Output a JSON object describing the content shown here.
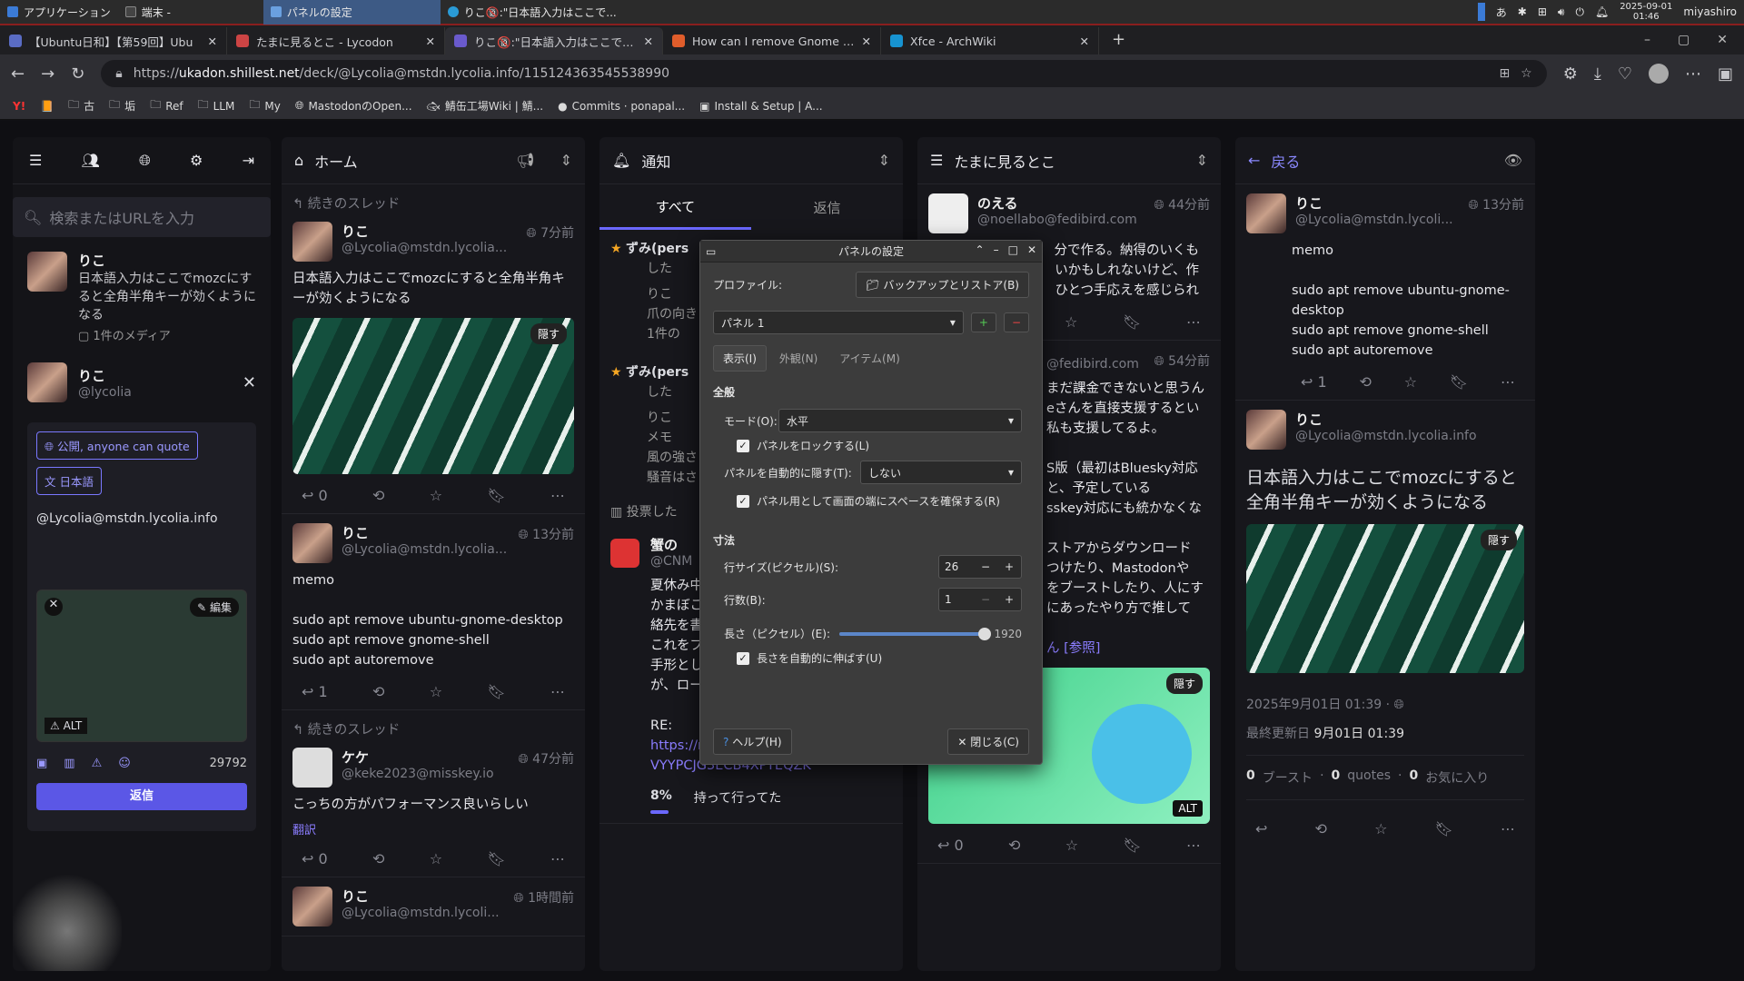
{
  "panel": {
    "apps": "アプリケーション",
    "tasks": [
      "端末 -",
      "パネルの設定",
      "りこ🔞:\"日本語入力はここで..."
    ],
    "user": "miyashiro",
    "date": "2025-09-01",
    "time": "01:46"
  },
  "tabs": [
    "【Ubuntu日和】【第59回】Ubu",
    "たまに見るとこ - Lycodon",
    "りこ🔞:\"日本語入力はここでmo",
    "How can I remove Gnome Desk",
    "Xfce - ArchWiki"
  ],
  "url": {
    "prefix": "https://",
    "host": "ukadon.shillest.net",
    "path": "/deck/@Lycolia@mstdn.lycolia.info/115124363545538990"
  },
  "bookmarks": [
    "古",
    "垢",
    "Ref",
    "LLM",
    "My",
    "MastodonのOpen...",
    "鯖缶工場Wiki | 鯖...",
    "Commits · ponapal...",
    "Install & Setup | A..."
  ],
  "compose": {
    "search_placeholder": "検索またはURLを入力",
    "user_name": "りこ",
    "user_handle": "@lycolia",
    "draft_name": "りこ",
    "draft_text": "日本語入力はここでmozcにすると全角半角キーが効くようになる",
    "draft_media": "1件のメディア",
    "visibility": "公開, anyone can quote",
    "language": "日本語",
    "body": "@Lycolia@mstdn.lycolia.info",
    "edit": "編集",
    "alt": "ALT",
    "count": "29792",
    "reply": "返信"
  },
  "home": {
    "title": "ホーム",
    "thread": "続きのスレッド",
    "p1": {
      "name": "りこ",
      "handle": "@Lycolia@mstdn.lycolia...",
      "time": "7分前",
      "body": "日本語入力はここでmozcにすると全角半角キーが効くようになる",
      "hide": "隠す",
      "reply": "0"
    },
    "p2": {
      "name": "りこ",
      "handle": "@Lycolia@mstdn.lycolia...",
      "time": "13分前",
      "l1": "memo",
      "l2": "sudo apt remove ubuntu-gnome-desktop",
      "l3": "sudo apt remove gnome-shell",
      "l4": "sudo apt autoremove",
      "reply": "1"
    },
    "thread2": "続きのスレッド",
    "p3": {
      "name": "ケケ",
      "handle": "@keke2023@misskey.io",
      "time": "47分前",
      "body": "こっちの方がパフォーマンス良いらしい",
      "translate": "翻訳",
      "reply": "0"
    },
    "p4": {
      "name": "りこ",
      "handle": "@Lycolia@mstdn.lycoli...",
      "time": "1時間前"
    }
  },
  "notif": {
    "title": "通知",
    "tab_all": "すべて",
    "tab_reply": "返信",
    "n1": "ずみ(pers",
    "n1b": "した",
    "n1c": "りこ",
    "n1d": "爪の向き",
    "n1e": "1件の",
    "n2": "ずみ(pers",
    "n2b": "した",
    "n2c": "りこ",
    "n2d": "メモ",
    "n2e": "風の強さ",
    "n2f": "騒音はさ",
    "poll": "投票した",
    "c_name": "蟹の",
    "c_handle": "@CNM",
    "c1": "夏休み中",
    "c2": "かまぼこ",
    "c3": "絡先を書",
    "c4": "これをプール入る時に監視の人に渡して手形とします。",
    "c5": "が、ローカルですかこれ🐱",
    "c6": "RE:",
    "c7": "https://nijimiss.moe/notes/01K1HB9VYYPCJG3ECB4XPYEQZK",
    "poll_pct": "8%",
    "poll_opt": "持って行ってた"
  },
  "tamani": {
    "title": "たまに見るとこ",
    "p1": {
      "name": "のえる",
      "handle": "@noellabo@fedibird.com",
      "time": "44分前",
      "t1": "分で作る。納得のいくも",
      "t2": "いかもしれないけど、作",
      "t3": "ひとつ手応えを感じられ"
    },
    "p2": {
      "handle": "@fedibird.com",
      "time": "54分前",
      "t1": "まだ課金できないと思うん",
      "t2": "eさんを直接支援するとい",
      "t3": "私も支援してるよ。",
      "t4": "S版（最初はBluesky対応",
      "t5": "と、予定している",
      "t6": "sskey対応にも統かなくな",
      "t7": "ストアからダウンロード",
      "t8": "つけたり、Mastodonや",
      "t9": "をブーストしたり、人にす",
      "t10": "にあったやり方で推して",
      "t11": "ん [参照]",
      "hide": "隠す",
      "alt": "ALT",
      "reply": "0"
    }
  },
  "detail": {
    "back": "戻る",
    "p1": {
      "name": "りこ",
      "handle": "@Lycolia@mstdn.lycoli...",
      "time": "13分前",
      "l1": "memo",
      "l2": "sudo apt remove ubuntu-gnome-desktop",
      "l3": "sudo apt remove gnome-shell",
      "l4": "sudo apt autoremove",
      "reply": "1"
    },
    "p2": {
      "name": "りこ",
      "handle": "@Lycolia@mstdn.lycolia.info",
      "body": "日本語入力はここでmozcにすると全角半角キーが効くようになる",
      "hide": "隠す",
      "date": "2025年9月01日 01:39",
      "edited_label": "最終更新日",
      "edited": "9月01日 01:39",
      "boost_n": "0",
      "boost": "ブースト",
      "quote_n": "0",
      "quote": "quotes",
      "fav_n": "0",
      "fav": "お気に入り"
    }
  },
  "dialog": {
    "title": "パネルの設定",
    "profile_label": "プロファイル:",
    "backup": "バックアップとリストア(B)",
    "panel": "パネル 1",
    "tab1": "表示(I)",
    "tab2": "外観(N)",
    "tab3": "アイテム(M)",
    "general": "全般",
    "mode_label": "モード(O):",
    "mode": "水平",
    "lock": "パネルをロックする(L)",
    "autohide_label": "パネルを自動的に隠す(T):",
    "autohide": "しない",
    "reserve": "パネル用として画面の端にスペースを確保する(R)",
    "size_header": "寸法",
    "rowsize_label": "行サイズ(ピクセル)(S):",
    "rowsize": "26",
    "rows_label": "行数(B):",
    "rows": "1",
    "length_label": "長さ（ピクセル）(E):",
    "length": "1920",
    "length_fraction": 1.0,
    "autolen": "長さを自動的に伸ばす(U)",
    "help": "ヘルプ(H)",
    "close": "閉じる(C)"
  }
}
